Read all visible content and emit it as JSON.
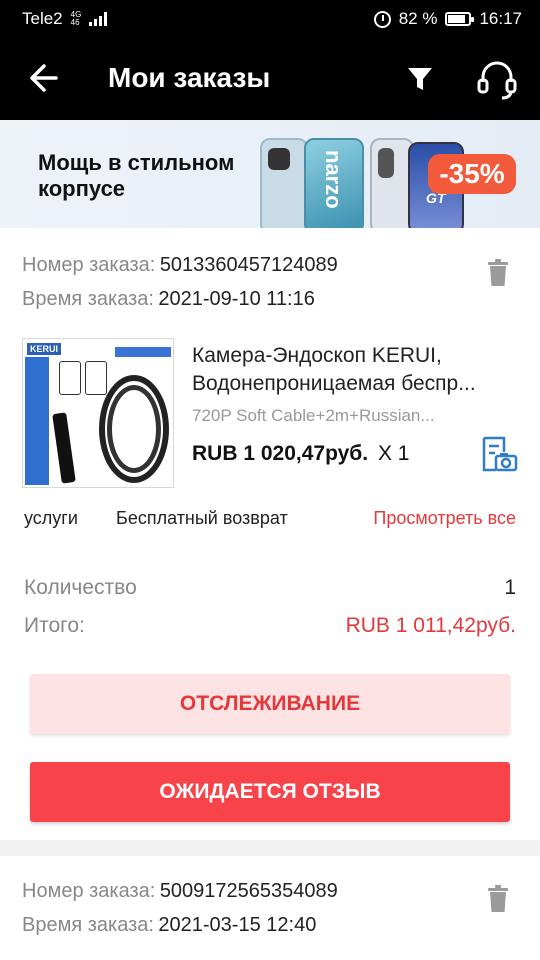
{
  "status_bar": {
    "carrier": "Tele2",
    "network_top": "4G",
    "network_bottom": "46",
    "battery_percent": "82 %",
    "time": "16:17"
  },
  "app_bar": {
    "title": "Мои заказы",
    "icons": [
      "back-arrow-icon",
      "filter-icon",
      "headset-icon"
    ]
  },
  "banner": {
    "line1": "Мощь в стильном",
    "line2": "корпусе",
    "phone_text_1": "narzo",
    "phone_text_2": "GT",
    "discount": "-35%"
  },
  "orders": [
    {
      "number_label": "Номер заказа:",
      "number": "5013360457124089",
      "time_label": "Время заказа:",
      "time": "2021-09-10 11:16",
      "product": {
        "brand_logo": "KERUI",
        "title_line1": "Камера-Эндоскоп KERUI,",
        "title_line2": "Водонепроницаемая беспр...",
        "variant": "720P Soft Cable+2m+Russian...",
        "price": "RUB 1 020,47руб.",
        "qty_text": "X 1"
      },
      "services": {
        "label": "услуги",
        "free_return": "Бесплатный возврат",
        "view_all": "Просмотреть все"
      },
      "quantity_label": "Количество",
      "quantity": "1",
      "total_label": "Итого:",
      "total": "RUB 1 011,42руб.",
      "track_button": "ОТСЛЕЖИВАНИЕ",
      "review_button": "ОЖИДАЕТСЯ ОТЗЫВ"
    },
    {
      "number_label": "Номер заказа:",
      "number": "5009172565354089",
      "time_label": "Время заказа:",
      "time": "2021-03-15 12:40"
    }
  ],
  "colors": {
    "accent_red": "#f8434a",
    "link_red": "#e5383b",
    "light_red_bg": "#fde3e3",
    "icon_blue": "#2f7dc8"
  }
}
